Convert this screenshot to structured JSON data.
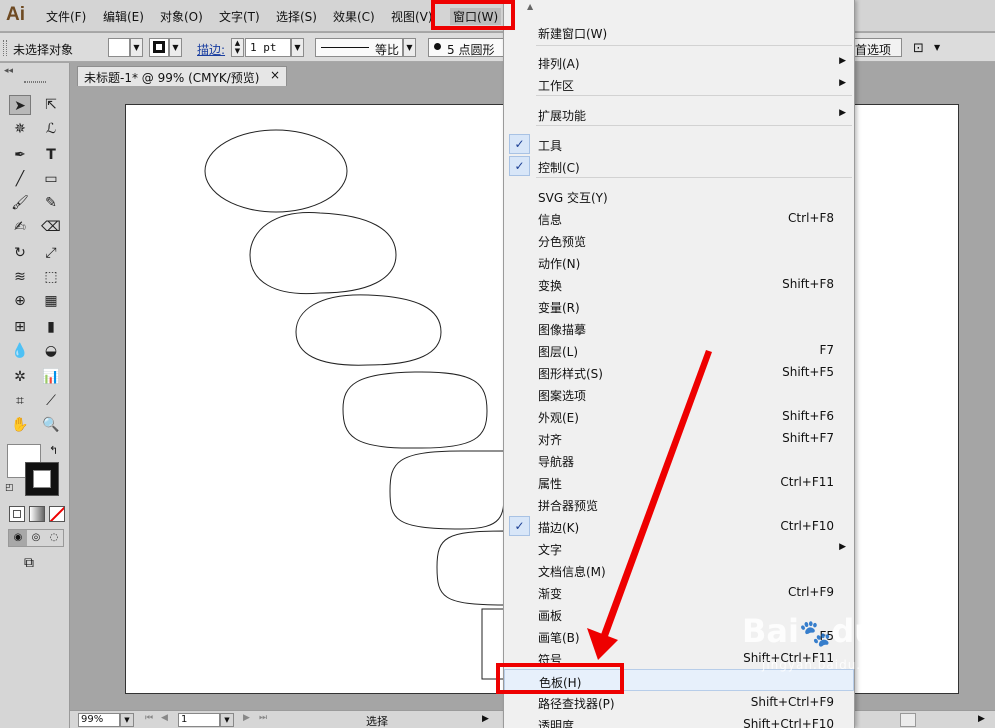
{
  "app": {
    "logo": "Ai"
  },
  "menubar": {
    "items": [
      "文件(F)",
      "编辑(E)",
      "对象(O)",
      "文字(T)",
      "选择(S)",
      "效果(C)",
      "视图(V)",
      "窗口(W)"
    ]
  },
  "controlbar": {
    "selection_label": "未选择对象",
    "stroke_label": "描边:",
    "stroke_weight": "1 pt",
    "stroke_profile": "等比",
    "brush": "5 点圆形",
    "prefs_label": "首选项"
  },
  "document": {
    "tab_title": "未标题-1* @ 99% (CMYK/预览)",
    "close_glyph": "×"
  },
  "statusbar": {
    "zoom": "99%",
    "page": "1",
    "tool_label": "选择"
  },
  "window_menu": {
    "items": [
      {
        "label": "新建窗口(W)",
        "shortcut": "",
        "submenu": false,
        "checked": false
      },
      {
        "label": "排列(A)",
        "shortcut": "",
        "submenu": true,
        "checked": false
      },
      {
        "label": "工作区",
        "shortcut": "",
        "submenu": true,
        "checked": false
      },
      {
        "label": "扩展功能",
        "shortcut": "",
        "submenu": true,
        "checked": false
      },
      {
        "label": "工具",
        "shortcut": "",
        "submenu": false,
        "checked": true
      },
      {
        "label": "控制(C)",
        "shortcut": "",
        "submenu": false,
        "checked": true
      },
      {
        "label": "SVG 交互(Y)",
        "shortcut": "",
        "submenu": false,
        "checked": false
      },
      {
        "label": "信息",
        "shortcut": "Ctrl+F8",
        "submenu": false,
        "checked": false
      },
      {
        "label": "分色预览",
        "shortcut": "",
        "submenu": false,
        "checked": false
      },
      {
        "label": "动作(N)",
        "shortcut": "",
        "submenu": false,
        "checked": false
      },
      {
        "label": "变换",
        "shortcut": "Shift+F8",
        "submenu": false,
        "checked": false
      },
      {
        "label": "变量(R)",
        "shortcut": "",
        "submenu": false,
        "checked": false
      },
      {
        "label": "图像描摹",
        "shortcut": "",
        "submenu": false,
        "checked": false
      },
      {
        "label": "图层(L)",
        "shortcut": "F7",
        "submenu": false,
        "checked": false
      },
      {
        "label": "图形样式(S)",
        "shortcut": "Shift+F5",
        "submenu": false,
        "checked": false
      },
      {
        "label": "图案选项",
        "shortcut": "",
        "submenu": false,
        "checked": false
      },
      {
        "label": "外观(E)",
        "shortcut": "Shift+F6",
        "submenu": false,
        "checked": false
      },
      {
        "label": "对齐",
        "shortcut": "Shift+F7",
        "submenu": false,
        "checked": false
      },
      {
        "label": "导航器",
        "shortcut": "",
        "submenu": false,
        "checked": false
      },
      {
        "label": "属性",
        "shortcut": "Ctrl+F11",
        "submenu": false,
        "checked": false
      },
      {
        "label": "拼合器预览",
        "shortcut": "",
        "submenu": false,
        "checked": false
      },
      {
        "label": "描边(K)",
        "shortcut": "Ctrl+F10",
        "submenu": false,
        "checked": true
      },
      {
        "label": "文字",
        "shortcut": "",
        "submenu": true,
        "checked": false
      },
      {
        "label": "文档信息(M)",
        "shortcut": "",
        "submenu": false,
        "checked": false
      },
      {
        "label": "渐变",
        "shortcut": "Ctrl+F9",
        "submenu": false,
        "checked": false
      },
      {
        "label": "画板",
        "shortcut": "",
        "submenu": false,
        "checked": false
      },
      {
        "label": "画笔(B)",
        "shortcut": "F5",
        "submenu": false,
        "checked": false
      },
      {
        "label": "符号",
        "shortcut": "Shift+Ctrl+F11",
        "submenu": false,
        "checked": false
      },
      {
        "label": "色板(H)",
        "shortcut": "",
        "submenu": false,
        "checked": false,
        "highlighted": true
      },
      {
        "label": "路径查找器(P)",
        "shortcut": "Shift+Ctrl+F9",
        "submenu": false,
        "checked": false
      },
      {
        "label": "透明度",
        "shortcut": "Shift+Ctrl+F10",
        "submenu": false,
        "checked": false
      }
    ]
  },
  "watermark": {
    "brand": "Bai",
    "brand2": "du",
    "product": "经验",
    "url": "jingyan.baidu.com"
  },
  "colors": {
    "annotation_red": "#ee0000",
    "menu_check": "#1c3f94",
    "app_logo": "#6e4a22"
  }
}
